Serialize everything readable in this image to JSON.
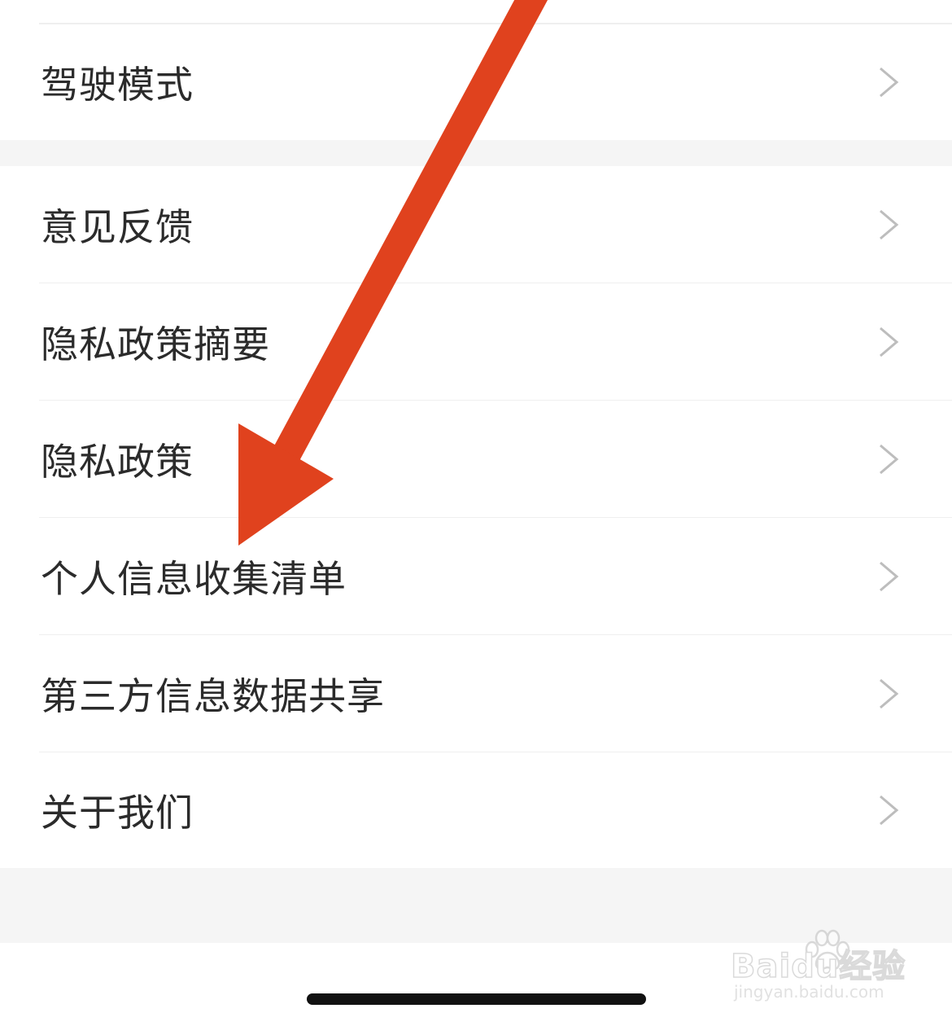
{
  "settings_list": {
    "items": [
      {
        "label": "驾驶模式"
      },
      {
        "label": "意见反馈"
      },
      {
        "label": "隐私政策摘要"
      },
      {
        "label": "隐私政策"
      },
      {
        "label": "个人信息收集清单"
      },
      {
        "label": "第三方信息数据共享"
      },
      {
        "label": "关于我们"
      }
    ]
  },
  "icons": {
    "row_chevron": "chevron-right-icon"
  },
  "annotation": {
    "arrow_color": "#E0421E",
    "target": "个人信息收集清单"
  },
  "watermark": {
    "brand": "Baidu经验",
    "url": "jingyan.baidu.com"
  },
  "colors": {
    "text": "#2b2b2b",
    "chevron": "#bdbdbd",
    "section_gap": "#f5f5f5",
    "divider": "#efefef",
    "arrow": "#E0421E"
  }
}
